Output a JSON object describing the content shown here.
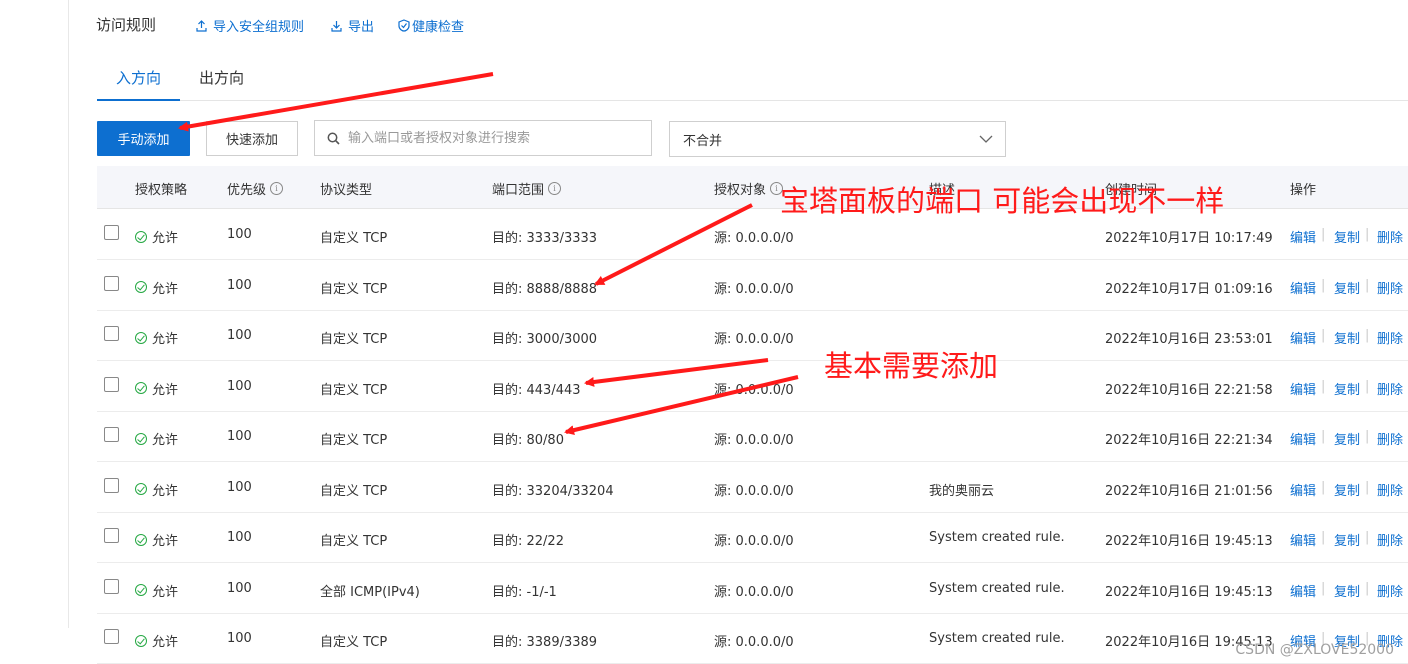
{
  "header": {
    "title": "访问规则",
    "import_label": "导入安全组规则",
    "export_label": "导出",
    "health_label": "健康检查"
  },
  "tabs": [
    {
      "label": "入方向",
      "active": true
    },
    {
      "label": "出方向",
      "active": false
    }
  ],
  "toolbar": {
    "manual_add_label": "手动添加",
    "quick_add_label": "快速添加",
    "search_placeholder": "输入端口或者授权对象进行搜索",
    "merge_select_value": "不合并"
  },
  "table": {
    "headers": {
      "policy": "授权策略",
      "priority": "优先级",
      "protocol": "协议类型",
      "port": "端口范围",
      "source": "授权对象",
      "desc": "描述",
      "created": "创建时间",
      "actions": "操作"
    },
    "rows": [
      {
        "policy": "允许",
        "priority": "100",
        "protocol": "自定义 TCP",
        "port": "目的: 3333/3333",
        "source": "源: 0.0.0.0/0",
        "desc": "",
        "created": "2022年10月17日 10:17:49"
      },
      {
        "policy": "允许",
        "priority": "100",
        "protocol": "自定义 TCP",
        "port": "目的: 8888/8888",
        "source": "源: 0.0.0.0/0",
        "desc": "",
        "created": "2022年10月17日 01:09:16"
      },
      {
        "policy": "允许",
        "priority": "100",
        "protocol": "自定义 TCP",
        "port": "目的: 3000/3000",
        "source": "源: 0.0.0.0/0",
        "desc": "",
        "created": "2022年10月16日 23:53:01"
      },
      {
        "policy": "允许",
        "priority": "100",
        "protocol": "自定义 TCP",
        "port": "目的: 443/443",
        "source": "源: 0.0.0.0/0",
        "desc": "",
        "created": "2022年10月16日 22:21:58"
      },
      {
        "policy": "允许",
        "priority": "100",
        "protocol": "自定义 TCP",
        "port": "目的: 80/80",
        "source": "源: 0.0.0.0/0",
        "desc": "",
        "created": "2022年10月16日 22:21:34"
      },
      {
        "policy": "允许",
        "priority": "100",
        "protocol": "自定义 TCP",
        "port": "目的: 33204/33204",
        "source": "源: 0.0.0.0/0",
        "desc": "我的奥丽云",
        "created": "2022年10月16日 21:01:56"
      },
      {
        "policy": "允许",
        "priority": "100",
        "protocol": "自定义 TCP",
        "port": "目的: 22/22",
        "source": "源: 0.0.0.0/0",
        "desc": "System created rule.",
        "created": "2022年10月16日 19:45:13"
      },
      {
        "policy": "允许",
        "priority": "100",
        "protocol": "全部 ICMP(IPv4)",
        "port": "目的: -1/-1",
        "source": "源: 0.0.0.0/0",
        "desc": "System created rule.",
        "created": "2022年10月16日 19:45:13"
      },
      {
        "policy": "允许",
        "priority": "100",
        "protocol": "自定义 TCP",
        "port": "目的: 3389/3389",
        "source": "源: 0.0.0.0/0",
        "desc": "System created rule.",
        "created": "2022年10月16日 19:45:13"
      }
    ],
    "actions": {
      "edit": "编辑",
      "copy": "复制",
      "delete": "删除"
    }
  },
  "annotations": {
    "panel_port_note": "宝塔面板的端口 可能会出现不一样",
    "basic_note": "基本需要添加",
    "color": "#ff1a1a"
  },
  "watermark": "CSDN @ZXLOVE52000",
  "colors": {
    "accent": "#0d6fd0",
    "allow": "#25a843"
  }
}
